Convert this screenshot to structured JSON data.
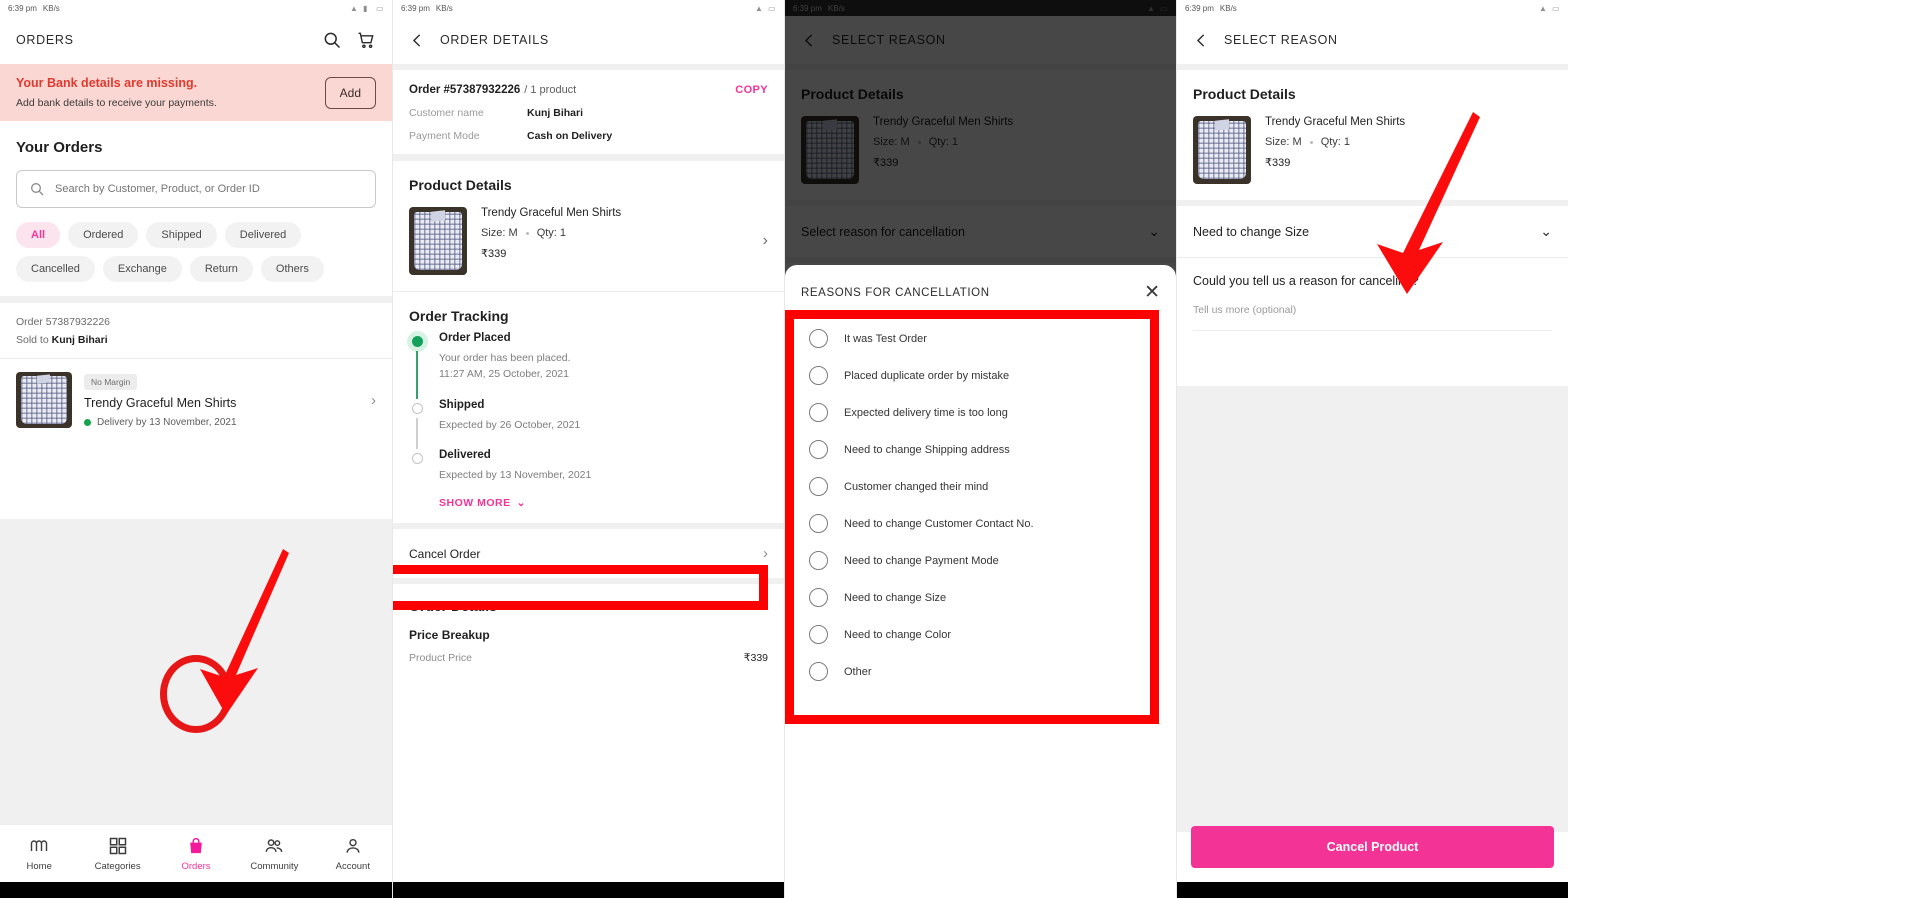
{
  "statusbar": {
    "time": "6:39 pm",
    "network": "KB/s"
  },
  "panel1": {
    "appbar": {
      "title": "ORDERS",
      "search_icon": "search-icon",
      "cart_icon": "cart-icon"
    },
    "bank_banner": {
      "title": "Your Bank details are missing.",
      "subtitle": "Add bank details to receive your payments.",
      "action": "Add"
    },
    "your_orders_heading": "Your Orders",
    "search": {
      "placeholder": "Search by Customer, Product, or Order ID"
    },
    "chips": [
      {
        "label": "All",
        "active": true
      },
      {
        "label": "Ordered",
        "active": false
      },
      {
        "label": "Shipped",
        "active": false
      },
      {
        "label": "Delivered",
        "active": false
      },
      {
        "label": "Cancelled",
        "active": false
      },
      {
        "label": "Exchange",
        "active": false
      },
      {
        "label": "Return",
        "active": false
      },
      {
        "label": "Others",
        "active": false
      }
    ],
    "order": {
      "order_id_line": "Order 57387932226",
      "sold_to_label": "Sold to",
      "sold_to_name": "Kunj Bihari",
      "badge": "No Margin",
      "product_name": "Trendy Graceful Men Shirts",
      "delivery": "Delivery by 13 November, 2021"
    },
    "bottom_nav": [
      {
        "label": "Home",
        "icon": "home-m-icon",
        "active": false
      },
      {
        "label": "Categories",
        "icon": "grid-icon",
        "active": false
      },
      {
        "label": "Orders",
        "icon": "bag-icon",
        "active": true
      },
      {
        "label": "Community",
        "icon": "people-icon",
        "active": false
      },
      {
        "label": "Account",
        "icon": "person-icon",
        "active": false
      }
    ]
  },
  "panel2": {
    "appbar": {
      "back_icon": "back-chevron-icon",
      "title": "ORDER DETAILS"
    },
    "order_header": {
      "order_number": "Order #57387932226",
      "product_count": "/ 1 product",
      "copy_label": "COPY"
    },
    "fields": [
      {
        "key": "Customer name",
        "value": "Kunj Bihari"
      },
      {
        "key": "Payment Mode",
        "value": "Cash on Delivery"
      }
    ],
    "product_details_heading": "Product Details",
    "product": {
      "name": "Trendy Graceful Men Shirts",
      "size": "Size: M",
      "qty": "Qty: 1",
      "price": "₹339"
    },
    "order_tracking_heading": "Order Tracking",
    "tracking": [
      {
        "title": "Order Placed",
        "line1": "Your order has been placed.",
        "line2": "11:27 AM, 25 October, 2021",
        "done": true
      },
      {
        "title": "Shipped",
        "line1": "Expected by 26 October, 2021",
        "line2": "",
        "done": false
      },
      {
        "title": "Delivered",
        "line1": "Expected by 13 November, 2021",
        "line2": "",
        "done": false
      }
    ],
    "show_more": "SHOW MORE",
    "cancel_order": "Cancel Order",
    "order_details_heading": "Order Details",
    "price_breakup_heading": "Price Breakup",
    "price_rows": [
      {
        "key": "Product Price",
        "value": "₹339"
      }
    ]
  },
  "panel3": {
    "appbar": {
      "back_icon": "back-chevron-icon",
      "title": "SELECT REASON"
    },
    "product_details_heading": "Product Details",
    "product": {
      "name": "Trendy Graceful Men Shirts",
      "size": "Size: M",
      "qty": "Qty: 1",
      "price": "₹339"
    },
    "select_reason_row": "Select reason for cancellation",
    "sheet": {
      "title": "REASONS FOR CANCELLATION",
      "close_icon": "close-icon",
      "reasons": [
        "It was Test Order",
        "Placed duplicate order by mistake",
        "Expected delivery time is too long",
        "Need to change Shipping address",
        "Customer changed their mind",
        "Need to change Customer Contact No.",
        "Need to change Payment Mode",
        "Need to change Size",
        "Need to change Color",
        "Other"
      ]
    }
  },
  "panel4": {
    "appbar": {
      "back_icon": "back-chevron-icon",
      "title": "SELECT REASON"
    },
    "product_details_heading": "Product Details",
    "product": {
      "name": "Trendy Graceful Men Shirts",
      "size": "Size: M",
      "qty": "Qty: 1",
      "price": "₹339"
    },
    "selected_reason": "Need to change Size",
    "ask_reason": "Could you tell us a reason for canceling?",
    "textarea_placeholder": "Tell us more (optional)",
    "cta": "Cancel Product"
  },
  "colors": {
    "accent_pink": "#f43397",
    "banner_bg": "#fbd7d4",
    "banner_text": "#e03a2f",
    "green": "#15a05c",
    "highlight_red": "#fd0000"
  }
}
